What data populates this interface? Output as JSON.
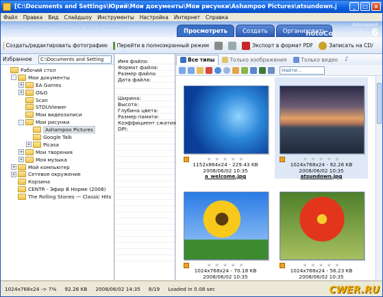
{
  "window": {
    "title": "[C:\\Documents and Settings\\Юрий\\Мои документы\\Мои рисунки\\Ashampoo Pictures\\atsundown.jpg] - Ashampoo"
  },
  "menu": [
    "Файл",
    "Правка",
    "Вид",
    "Слайдшоу",
    "Инструменты",
    "Настройка",
    "Интернет",
    "Справка"
  ],
  "ribbon": {
    "tabs": [
      "Просмотреть",
      "Создать",
      "Организовать"
    ],
    "active_tab": 0,
    "brand_small": "Ashampoo®",
    "brand_big": "hotoCommander",
    "brand_version": "6",
    "ghost_text": "Создать/редактировать фотографию"
  },
  "actions": {
    "edit": "Создать/редактировать фотографию",
    "fullscreen": "Перейти в полноэкранный режим",
    "export_pdf": "Экспорт в формат PDF",
    "burn_cd": "Записать на CD/"
  },
  "left": {
    "favorites_label": "Избранное",
    "path_value": "C:\\Documents and Setting",
    "tree": [
      {
        "label": "Рабочий стол",
        "level": 0,
        "exp": ""
      },
      {
        "label": "Мои документы",
        "level": 1,
        "exp": "-"
      },
      {
        "label": "EA Games",
        "level": 2,
        "exp": "+"
      },
      {
        "label": "O&O",
        "level": 2,
        "exp": "+"
      },
      {
        "label": "Scan",
        "level": 2,
        "exp": ""
      },
      {
        "label": "STDUViewer",
        "level": 2,
        "exp": ""
      },
      {
        "label": "Мои видеозаписи",
        "level": 2,
        "exp": ""
      },
      {
        "label": "Мои рисунки",
        "level": 2,
        "exp": "-"
      },
      {
        "label": "Ashampoo Pictures",
        "level": 3,
        "exp": "",
        "selected": true
      },
      {
        "label": "Google Talk",
        "level": 3,
        "exp": ""
      },
      {
        "label": "Picasa",
        "level": 3,
        "exp": "+"
      },
      {
        "label": "Мои творения",
        "level": 2,
        "exp": "+"
      },
      {
        "label": "Моя музыка",
        "level": 2,
        "exp": "+"
      },
      {
        "label": "Мой компьютер",
        "level": 1,
        "exp": "+"
      },
      {
        "label": "Сетевое окружение",
        "level": 1,
        "exp": "+"
      },
      {
        "label": "Корзина",
        "level": 1,
        "exp": ""
      },
      {
        "label": "CENTR - Эфир В Норме (2008)",
        "level": 1,
        "exp": ""
      },
      {
        "label": "The Rolling Stones — Classic Hits",
        "level": 1,
        "exp": ""
      }
    ]
  },
  "properties": {
    "rows": [
      "Имя файла:",
      "Формат файла:",
      "Размер файла:",
      "Дата файла:",
      "",
      "",
      "Ширина:",
      "Высота:",
      "Глубина цвета:",
      "Размер памяти:",
      "Коэффициент сжатия:",
      "DPI:"
    ]
  },
  "browser": {
    "filter_tabs": [
      "Все типы",
      "Только изображения",
      "Только видео",
      ""
    ],
    "search_placeholder": "Найти...",
    "thumbnails": [
      {
        "dims": "1152x864x24 - 229.43 KB",
        "date": "2008/06/02 10:35",
        "name": "a_welcome.jpg",
        "selected": false,
        "stars": "★ ★ ★ ★ ★"
      },
      {
        "dims": "1024x768x24 - 92.26 KB",
        "date": "2008/06/02 10:35",
        "name": "atsundown.jpg",
        "selected": true,
        "stars": "★ ★ ★ ★ ★"
      },
      {
        "dims": "1024x768x24 - 70.18 KB",
        "date": "2008/06/02 10:35",
        "name": "",
        "selected": false,
        "stars": "★ ★ ★ ★ ★"
      },
      {
        "dims": "1024x768x24 - 56.23 KB",
        "date": "2008/06/02 10:35",
        "name": "",
        "selected": false,
        "stars": "★ ★ ★ ★ ★"
      }
    ]
  },
  "status": {
    "dims": "1024x768x24 -> 7%",
    "size": "92.26 KB",
    "date": "2008/06/02 14:35",
    "index": "8/19",
    "loaded": "Loaded in 0.08 sec"
  },
  "watermark": "CWER.RU",
  "colors": {
    "title_blue": "#0b5ee0",
    "accent": "#3a6fc6",
    "selection": "#dfe8f6"
  }
}
